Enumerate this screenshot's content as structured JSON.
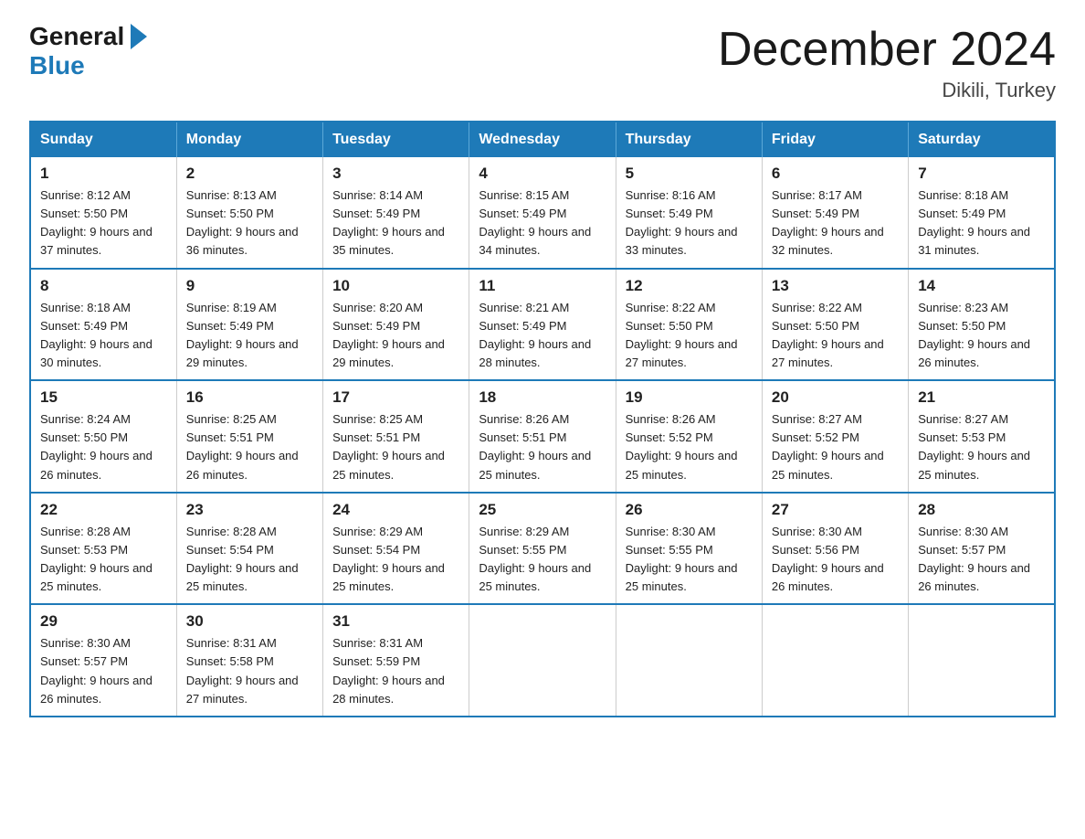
{
  "header": {
    "logo_general": "General",
    "logo_blue": "Blue",
    "title": "December 2024",
    "subtitle": "Dikili, Turkey"
  },
  "days_of_week": [
    "Sunday",
    "Monday",
    "Tuesday",
    "Wednesday",
    "Thursday",
    "Friday",
    "Saturday"
  ],
  "weeks": [
    [
      {
        "day": "1",
        "info": "Sunrise: 8:12 AM\nSunset: 5:50 PM\nDaylight: 9 hours\nand 37 minutes."
      },
      {
        "day": "2",
        "info": "Sunrise: 8:13 AM\nSunset: 5:50 PM\nDaylight: 9 hours\nand 36 minutes."
      },
      {
        "day": "3",
        "info": "Sunrise: 8:14 AM\nSunset: 5:49 PM\nDaylight: 9 hours\nand 35 minutes."
      },
      {
        "day": "4",
        "info": "Sunrise: 8:15 AM\nSunset: 5:49 PM\nDaylight: 9 hours\nand 34 minutes."
      },
      {
        "day": "5",
        "info": "Sunrise: 8:16 AM\nSunset: 5:49 PM\nDaylight: 9 hours\nand 33 minutes."
      },
      {
        "day": "6",
        "info": "Sunrise: 8:17 AM\nSunset: 5:49 PM\nDaylight: 9 hours\nand 32 minutes."
      },
      {
        "day": "7",
        "info": "Sunrise: 8:18 AM\nSunset: 5:49 PM\nDaylight: 9 hours\nand 31 minutes."
      }
    ],
    [
      {
        "day": "8",
        "info": "Sunrise: 8:18 AM\nSunset: 5:49 PM\nDaylight: 9 hours\nand 30 minutes."
      },
      {
        "day": "9",
        "info": "Sunrise: 8:19 AM\nSunset: 5:49 PM\nDaylight: 9 hours\nand 29 minutes."
      },
      {
        "day": "10",
        "info": "Sunrise: 8:20 AM\nSunset: 5:49 PM\nDaylight: 9 hours\nand 29 minutes."
      },
      {
        "day": "11",
        "info": "Sunrise: 8:21 AM\nSunset: 5:49 PM\nDaylight: 9 hours\nand 28 minutes."
      },
      {
        "day": "12",
        "info": "Sunrise: 8:22 AM\nSunset: 5:50 PM\nDaylight: 9 hours\nand 27 minutes."
      },
      {
        "day": "13",
        "info": "Sunrise: 8:22 AM\nSunset: 5:50 PM\nDaylight: 9 hours\nand 27 minutes."
      },
      {
        "day": "14",
        "info": "Sunrise: 8:23 AM\nSunset: 5:50 PM\nDaylight: 9 hours\nand 26 minutes."
      }
    ],
    [
      {
        "day": "15",
        "info": "Sunrise: 8:24 AM\nSunset: 5:50 PM\nDaylight: 9 hours\nand 26 minutes."
      },
      {
        "day": "16",
        "info": "Sunrise: 8:25 AM\nSunset: 5:51 PM\nDaylight: 9 hours\nand 26 minutes."
      },
      {
        "day": "17",
        "info": "Sunrise: 8:25 AM\nSunset: 5:51 PM\nDaylight: 9 hours\nand 25 minutes."
      },
      {
        "day": "18",
        "info": "Sunrise: 8:26 AM\nSunset: 5:51 PM\nDaylight: 9 hours\nand 25 minutes."
      },
      {
        "day": "19",
        "info": "Sunrise: 8:26 AM\nSunset: 5:52 PM\nDaylight: 9 hours\nand 25 minutes."
      },
      {
        "day": "20",
        "info": "Sunrise: 8:27 AM\nSunset: 5:52 PM\nDaylight: 9 hours\nand 25 minutes."
      },
      {
        "day": "21",
        "info": "Sunrise: 8:27 AM\nSunset: 5:53 PM\nDaylight: 9 hours\nand 25 minutes."
      }
    ],
    [
      {
        "day": "22",
        "info": "Sunrise: 8:28 AM\nSunset: 5:53 PM\nDaylight: 9 hours\nand 25 minutes."
      },
      {
        "day": "23",
        "info": "Sunrise: 8:28 AM\nSunset: 5:54 PM\nDaylight: 9 hours\nand 25 minutes."
      },
      {
        "day": "24",
        "info": "Sunrise: 8:29 AM\nSunset: 5:54 PM\nDaylight: 9 hours\nand 25 minutes."
      },
      {
        "day": "25",
        "info": "Sunrise: 8:29 AM\nSunset: 5:55 PM\nDaylight: 9 hours\nand 25 minutes."
      },
      {
        "day": "26",
        "info": "Sunrise: 8:30 AM\nSunset: 5:55 PM\nDaylight: 9 hours\nand 25 minutes."
      },
      {
        "day": "27",
        "info": "Sunrise: 8:30 AM\nSunset: 5:56 PM\nDaylight: 9 hours\nand 26 minutes."
      },
      {
        "day": "28",
        "info": "Sunrise: 8:30 AM\nSunset: 5:57 PM\nDaylight: 9 hours\nand 26 minutes."
      }
    ],
    [
      {
        "day": "29",
        "info": "Sunrise: 8:30 AM\nSunset: 5:57 PM\nDaylight: 9 hours\nand 26 minutes."
      },
      {
        "day": "30",
        "info": "Sunrise: 8:31 AM\nSunset: 5:58 PM\nDaylight: 9 hours\nand 27 minutes."
      },
      {
        "day": "31",
        "info": "Sunrise: 8:31 AM\nSunset: 5:59 PM\nDaylight: 9 hours\nand 28 minutes."
      },
      {
        "day": "",
        "info": ""
      },
      {
        "day": "",
        "info": ""
      },
      {
        "day": "",
        "info": ""
      },
      {
        "day": "",
        "info": ""
      }
    ]
  ]
}
